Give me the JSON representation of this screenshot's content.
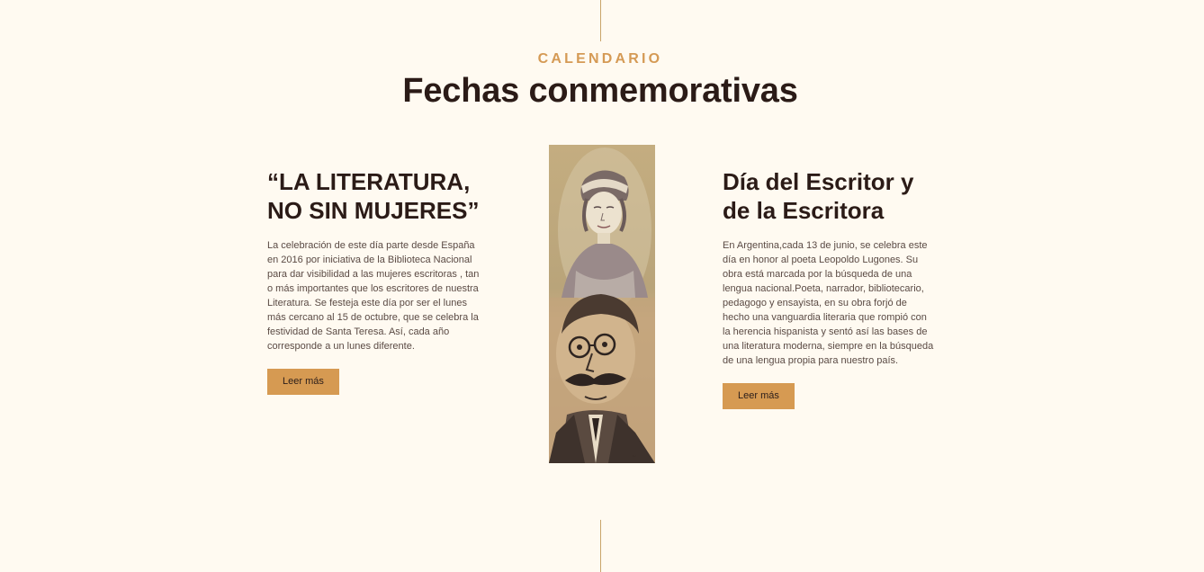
{
  "header": {
    "eyebrow": "CALENDARIO",
    "title": "Fechas conmemorativas"
  },
  "cards": [
    {
      "title": "“LA LITERATURA,\nNO SIN MUJERES”",
      "body": "La celebración de este día parte desde España en 2016 por iniciativa de la Biblioteca Nacional para dar visibilidad a las mujeres escritoras , tan o más importantes que los escritores de nuestra Literatura. Se festeja este día por ser el lunes más cercano al 15 de octubre, que se celebra la festividad de Santa Teresa. Así, cada año corresponde a un lunes diferente.",
      "button": "Leer más"
    },
    {
      "title": "Día del Escritor y\nde la Escritora",
      "body": "En Argentina,cada 13 de junio, se celebra este día en honor al poeta Leopoldo Lugones. Su obra está marcada por la búsqueda de una lengua nacional.Poeta, narrador, bibliotecario, pedagogo y ensayista, en su obra forjó de hecho una vanguardia literaria que rompió con la herencia hispanista y sentó así las bases de una literatura moderna, siempre en la búsqueda de una lengua propia para nuestro país.",
      "button": "Leer más"
    }
  ],
  "colors": {
    "background": "#fffaf1",
    "accent": "#d69a52",
    "heading": "#2b1b17",
    "body_text": "#5a4a44"
  }
}
